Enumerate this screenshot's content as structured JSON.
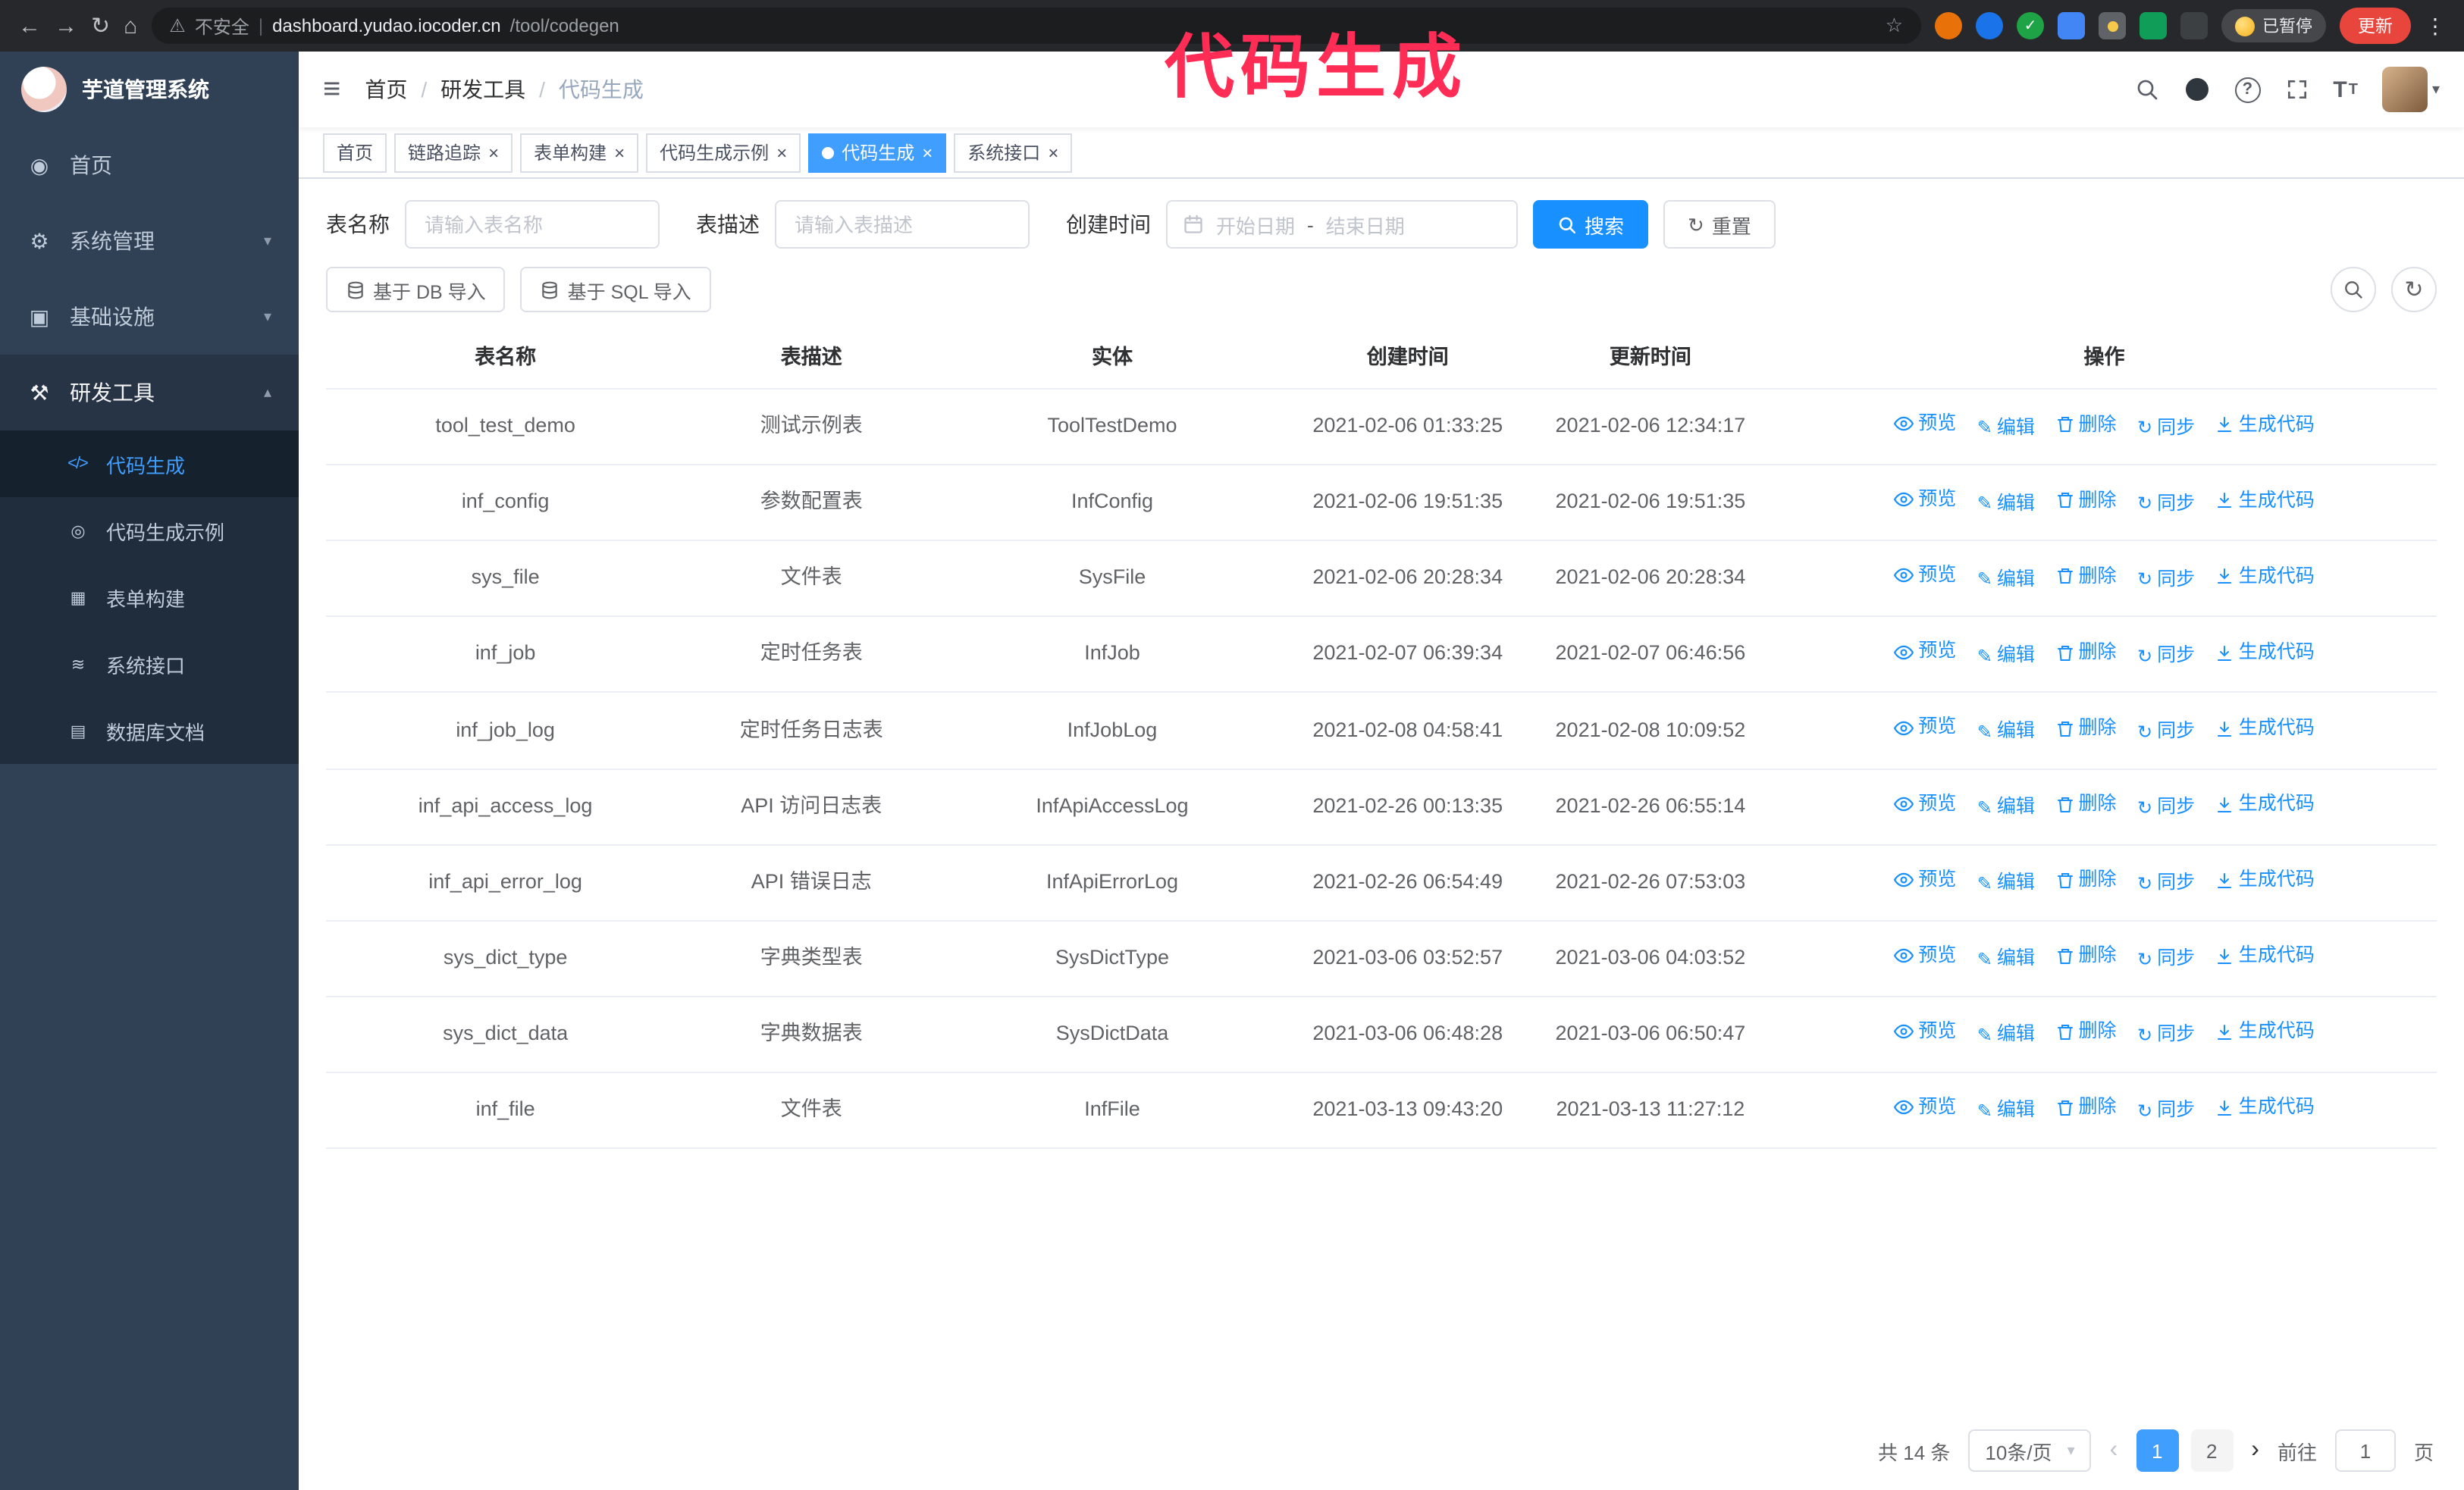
{
  "colors": {
    "accent": "#409eff",
    "link": "#1890ff",
    "annotation": "#ff2d55",
    "sidebar_bg": "#304156",
    "chrome_bg": "#26282b"
  },
  "annotation_text": "代码生成",
  "browser": {
    "security_label": "不安全",
    "url_host": "dashboard.yudao.iocoder.cn",
    "url_path": "/tool/codegen",
    "paused_badge": "已暂停",
    "update_button": "更新"
  },
  "icons": {
    "back": "←",
    "forward": "→",
    "reload": "↻",
    "home": "⌂",
    "warning": "⚠",
    "star": "☆",
    "divider": "|",
    "menu": "⋮",
    "hamburger": "≡",
    "close": "×",
    "caret_down": "▾",
    "caret_up": "▴",
    "chevron_left": "‹",
    "chevron_right": "›",
    "sync": "↻",
    "edit": "✎",
    "nav_home": "◉",
    "nav_system": "⚙",
    "nav_infra": "▣",
    "nav_dev": "⚒",
    "sub_codegen": "</>",
    "sub_demo": "◎",
    "sub_form": "▦",
    "sub_api": "≋",
    "sub_db_doc": "▤"
  },
  "sidebar": {
    "logo_title": "芋道管理系统",
    "items": [
      {
        "label": "首页"
      },
      {
        "label": "系统管理"
      },
      {
        "label": "基础设施"
      },
      {
        "label": "研发工具"
      }
    ],
    "sub_items": [
      {
        "label": "代码生成"
      },
      {
        "label": "代码生成示例"
      },
      {
        "label": "表单构建"
      },
      {
        "label": "系统接口"
      },
      {
        "label": "数据库文档"
      }
    ]
  },
  "header": {
    "breadcrumb": [
      "首页",
      "研发工具",
      "代码生成"
    ],
    "separator": "/"
  },
  "tabs": [
    {
      "label": "首页"
    },
    {
      "label": "链路追踪"
    },
    {
      "label": "表单构建"
    },
    {
      "label": "代码生成示例"
    },
    {
      "label": "代码生成"
    },
    {
      "label": "系统接口"
    }
  ],
  "filters": {
    "table_name_label": "表名称",
    "table_name_placeholder": "请输入表名称",
    "table_desc_label": "表描述",
    "table_desc_placeholder": "请输入表描述",
    "create_time_label": "创建时间",
    "date_start_placeholder": "开始日期",
    "date_separator": "-",
    "date_end_placeholder": "结束日期",
    "search_button": "搜索",
    "reset_button": "重置"
  },
  "toolbar": {
    "import_db": "基于 DB 导入",
    "import_sql": "基于 SQL 导入"
  },
  "table": {
    "columns": [
      "表名称",
      "表描述",
      "实体",
      "创建时间",
      "更新时间",
      "操作"
    ],
    "actions": [
      "预览",
      "编辑",
      "删除",
      "同步",
      "生成代码"
    ],
    "rows": [
      {
        "name": "tool_test_demo",
        "desc": "测试示例表",
        "entity": "ToolTestDemo",
        "created": "2021-02-06 01:33:25",
        "updated": "2021-02-06 12:34:17"
      },
      {
        "name": "inf_config",
        "desc": "参数配置表",
        "entity": "InfConfig",
        "created": "2021-02-06 19:51:35",
        "updated": "2021-02-06 19:51:35"
      },
      {
        "name": "sys_file",
        "desc": "文件表",
        "entity": "SysFile",
        "created": "2021-02-06 20:28:34",
        "updated": "2021-02-06 20:28:34"
      },
      {
        "name": "inf_job",
        "desc": "定时任务表",
        "entity": "InfJob",
        "created": "2021-02-07 06:39:34",
        "updated": "2021-02-07 06:46:56"
      },
      {
        "name": "inf_job_log",
        "desc": "定时任务日志表",
        "entity": "InfJobLog",
        "created": "2021-02-08 04:58:41",
        "updated": "2021-02-08 10:09:52"
      },
      {
        "name": "inf_api_access_log",
        "desc": "API 访问日志表",
        "entity": "InfApiAccessLog",
        "created": "2021-02-26 00:13:35",
        "updated": "2021-02-26 06:55:14"
      },
      {
        "name": "inf_api_error_log",
        "desc": "API 错误日志",
        "entity": "InfApiErrorLog",
        "created": "2021-02-26 06:54:49",
        "updated": "2021-02-26 07:53:03"
      },
      {
        "name": "sys_dict_type",
        "desc": "字典类型表",
        "entity": "SysDictType",
        "created": "2021-03-06 03:52:57",
        "updated": "2021-03-06 04:03:52"
      },
      {
        "name": "sys_dict_data",
        "desc": "字典数据表",
        "entity": "SysDictData",
        "created": "2021-03-06 06:48:28",
        "updated": "2021-03-06 06:50:47"
      },
      {
        "name": "inf_file",
        "desc": "文件表",
        "entity": "InfFile",
        "created": "2021-03-13 09:43:20",
        "updated": "2021-03-13 11:27:12"
      }
    ]
  },
  "pagination": {
    "total": "共 14 条",
    "page_size": "10条/页",
    "pages": [
      "1",
      "2"
    ],
    "active_page": "1",
    "goto_label": "前往",
    "goto_value": "1",
    "unit_label": "页"
  }
}
